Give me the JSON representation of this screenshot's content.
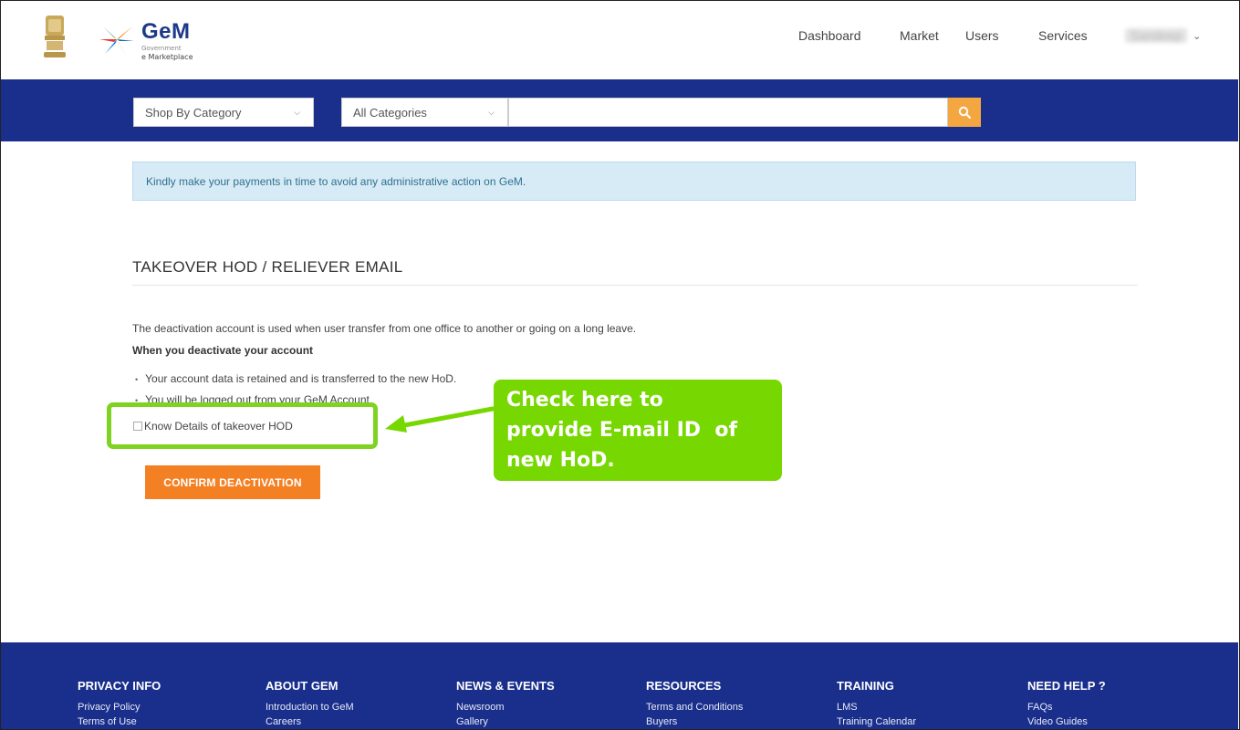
{
  "header": {
    "logo_title": "GeM",
    "logo_sub1": "Government",
    "logo_sub2": "e Marketplace",
    "nav": [
      "Dashboard",
      "Market",
      "Users",
      "Services"
    ],
    "user_name": "Sandeep",
    "user_caret_icon": "chevron-down-icon"
  },
  "search": {
    "shop_by_category": "Shop By Category",
    "all_categories": "All Categories",
    "placeholder": "",
    "search_icon": "search-icon",
    "accent": "#f4a640"
  },
  "alert": {
    "text": "Kindly make your payments in time to avoid any administrative action on GeM."
  },
  "main": {
    "title": "TAKEOVER HOD / RELIEVER EMAIL",
    "description": "The deactivation account is used when user transfer from one office to another or going on a long leave.",
    "subheading": "When you deactivate your account",
    "bullets": [
      "Your account data is retained and is transferred to the new HoD.",
      "You will be logged out from your GeM Account"
    ],
    "checkbox_label": "Know Details of takeover HOD",
    "confirm_label": "CONFIRM DEACTIVATION"
  },
  "annotation": {
    "callout_text_1": "Check here to",
    "callout_text_2": "provide E-mail ID  of",
    "callout_text_3": "new HoD.",
    "color": "#77d700"
  },
  "footer": {
    "columns": [
      {
        "title": "PRIVACY INFO",
        "links": [
          "Privacy Policy",
          "Terms of Use"
        ]
      },
      {
        "title": "ABOUT GEM",
        "links": [
          "Introduction to GeM",
          "Careers"
        ]
      },
      {
        "title": "NEWS & EVENTS",
        "links": [
          "Newsroom",
          "Gallery"
        ]
      },
      {
        "title": "RESOURCES",
        "links": [
          "Terms and Conditions",
          "Buyers"
        ]
      },
      {
        "title": "TRAINING",
        "links": [
          "LMS",
          "Training Calendar"
        ]
      },
      {
        "title": "NEED HELP ?",
        "links": [
          "FAQs",
          "Video Guides"
        ]
      }
    ]
  },
  "colors": {
    "brand_blue": "#1a2f8c",
    "button_orange": "#f48024"
  }
}
